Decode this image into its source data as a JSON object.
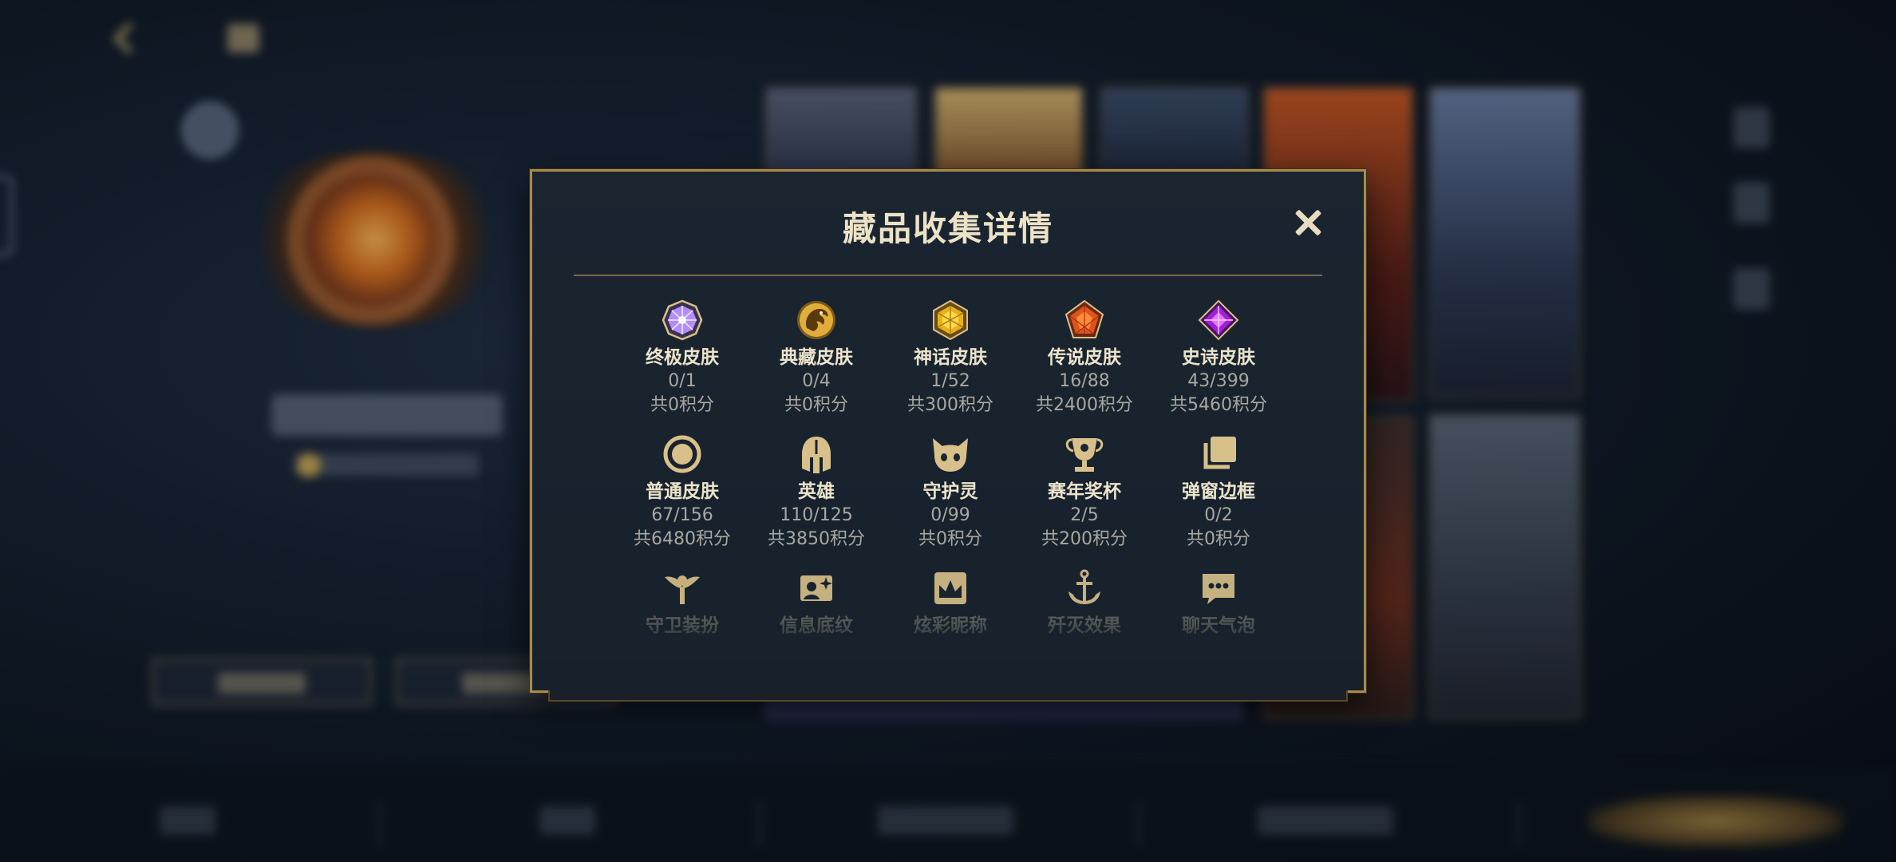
{
  "modal": {
    "title": "藏品收集详情",
    "items": [
      {
        "label": "终极皮肤",
        "count": "0/1",
        "score": "共0积分",
        "icon": "ultimate-skin-gem-icon"
      },
      {
        "label": "典藏皮肤",
        "count": "0/4",
        "score": "共0积分",
        "icon": "prestige-skin-dragon-icon"
      },
      {
        "label": "神话皮肤",
        "count": "1/52",
        "score": "共300积分",
        "icon": "mythic-skin-gem-icon"
      },
      {
        "label": "传说皮肤",
        "count": "16/88",
        "score": "共2400积分",
        "icon": "legendary-skin-gem-icon"
      },
      {
        "label": "史诗皮肤",
        "count": "43/399",
        "score": "共5460积分",
        "icon": "epic-skin-gem-icon"
      },
      {
        "label": "普通皮肤",
        "count": "67/156",
        "score": "共6480积分",
        "icon": "normal-skin-ring-icon"
      },
      {
        "label": "英雄",
        "count": "110/125",
        "score": "共3850积分",
        "icon": "champion-helmet-icon"
      },
      {
        "label": "守护灵",
        "count": "0/99",
        "score": "共0积分",
        "icon": "guardian-pet-icon"
      },
      {
        "label": "赛年奖杯",
        "count": "2/5",
        "score": "共200积分",
        "icon": "season-trophy-icon"
      },
      {
        "label": "弹窗边框",
        "count": "0/2",
        "score": "共0积分",
        "icon": "popup-frame-icon"
      },
      {
        "label": "守卫装扮",
        "icon": "ward-skin-icon"
      },
      {
        "label": "信息底纹",
        "icon": "info-banner-icon"
      },
      {
        "label": "炫彩昵称",
        "icon": "crown-nickname-icon"
      },
      {
        "label": "歼灭效果",
        "icon": "ace-effect-icon"
      },
      {
        "label": "聊天气泡",
        "icon": "chat-bubble-icon"
      }
    ]
  },
  "colors": {
    "accent_gold": "#a88a4a",
    "icon_gold": "#d8c08a",
    "ultimate": "#b48cff",
    "mythic": "#e8b11c",
    "legendary": "#e0541c",
    "epic": "#a21fd6"
  }
}
